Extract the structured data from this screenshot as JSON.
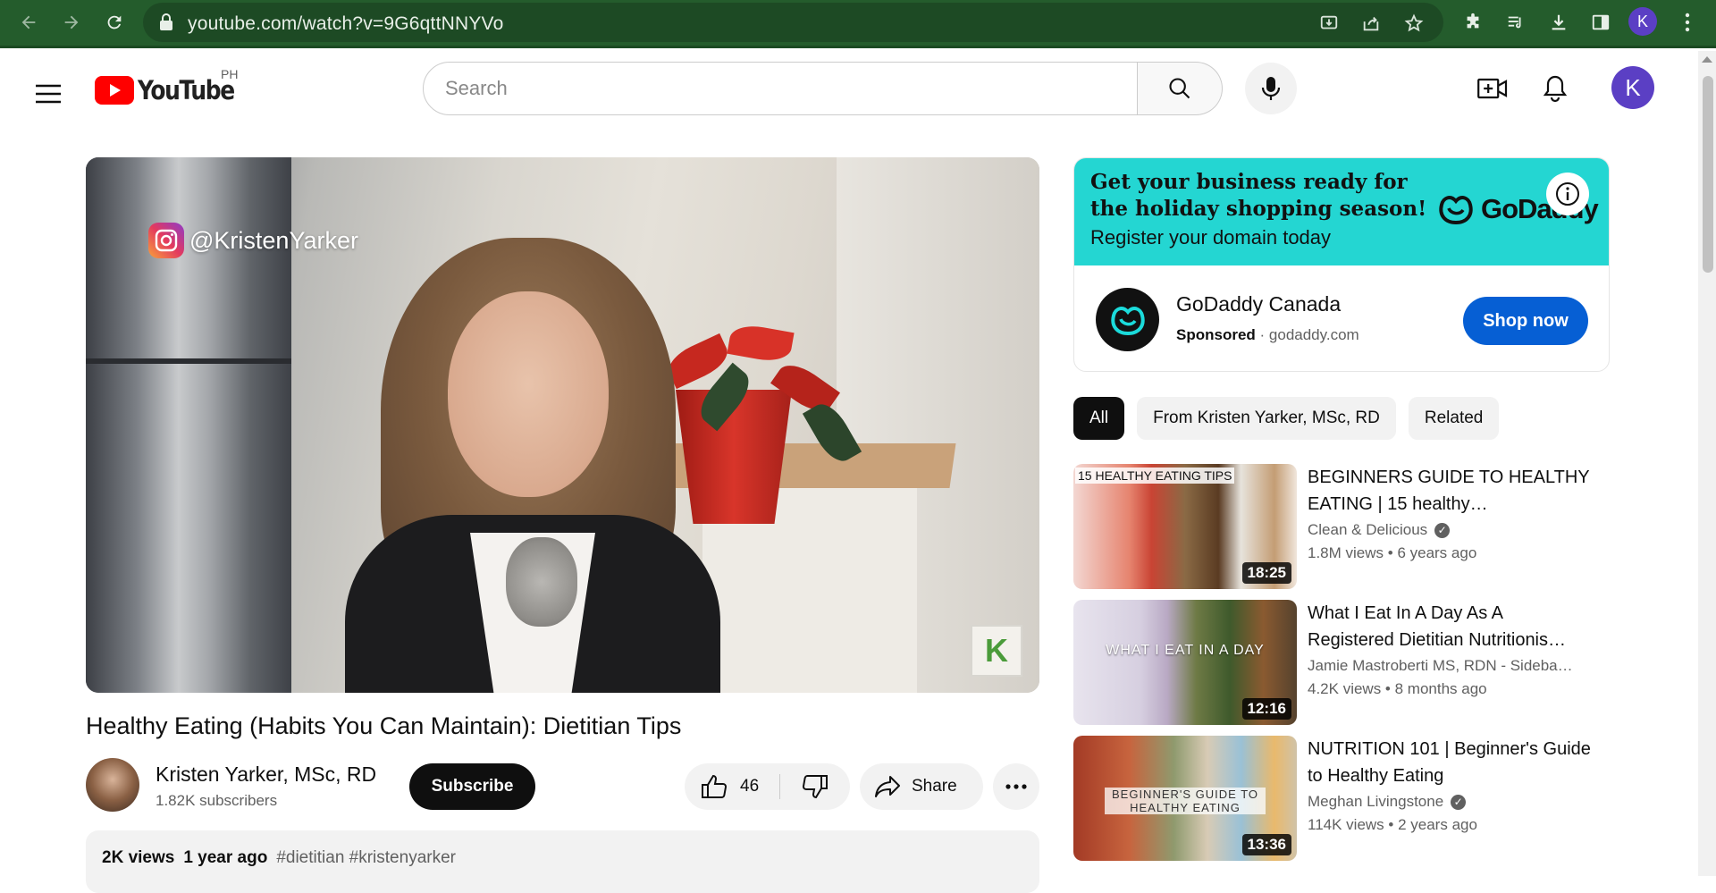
{
  "browser": {
    "url": "youtube.com/watch?v=9G6qttNNYVo",
    "avatar_letter": "K"
  },
  "masthead": {
    "logo_text": "YouTube",
    "region": "PH",
    "search_placeholder": "Search",
    "avatar_letter": "K"
  },
  "player": {
    "ig_handle": "@KristenYarker"
  },
  "video": {
    "title": "Healthy Eating (Habits You Can Maintain): Dietitian Tips",
    "channel_name": "Kristen Yarker, MSc, RD",
    "subscribers": "1.82K subscribers",
    "subscribe_label": "Subscribe",
    "like_count": "46",
    "share_label": "Share",
    "views": "2K views",
    "age": "1 year ago",
    "tags": "#dietitian #kristenyarker"
  },
  "ad": {
    "headline_line1": "Get your business ready for",
    "headline_line2": "the holiday shopping season!",
    "subline": "Register your domain today",
    "brand": "GoDaddy",
    "advertiser": "GoDaddy Canada",
    "sponsored": "Sponsored",
    "domain": "godaddy.com",
    "cta": "Shop now"
  },
  "chips": [
    "All",
    "From Kristen Yarker, MSc, RD",
    "Related"
  ],
  "related": [
    {
      "title": "BEGINNERS GUIDE TO HEALTHY EATING | 15 healthy…",
      "channel": "Clean & Delicious",
      "verified": true,
      "views": "1.8M views",
      "age": "6 years ago",
      "duration": "18:25",
      "thumb_text": "15 HEALTHY EATING TIPS"
    },
    {
      "title": "What I Eat In A Day As A Registered Dietitian Nutritionis…",
      "channel": "Jamie Mastroberti MS, RDN - Sideba…",
      "verified": false,
      "views": "4.2K views",
      "age": "8 months ago",
      "duration": "12:16",
      "thumb_text": "WHAT I EAT IN A DAY"
    },
    {
      "title": "NUTRITION 101 | Beginner's Guide to Healthy Eating",
      "channel": "Meghan Livingstone",
      "verified": true,
      "views": "114K views",
      "age": "2 years ago",
      "duration": "13:36",
      "thumb_text": "BEGINNER'S GUIDE TO HEALTHY EATING"
    }
  ],
  "colors": {
    "browser_chrome": "#245c2c",
    "youtube_red": "#ff0000",
    "ad_banner": "#24d6d2",
    "cta_blue": "#065fd4",
    "avatar_purple": "#5b3fc4"
  }
}
